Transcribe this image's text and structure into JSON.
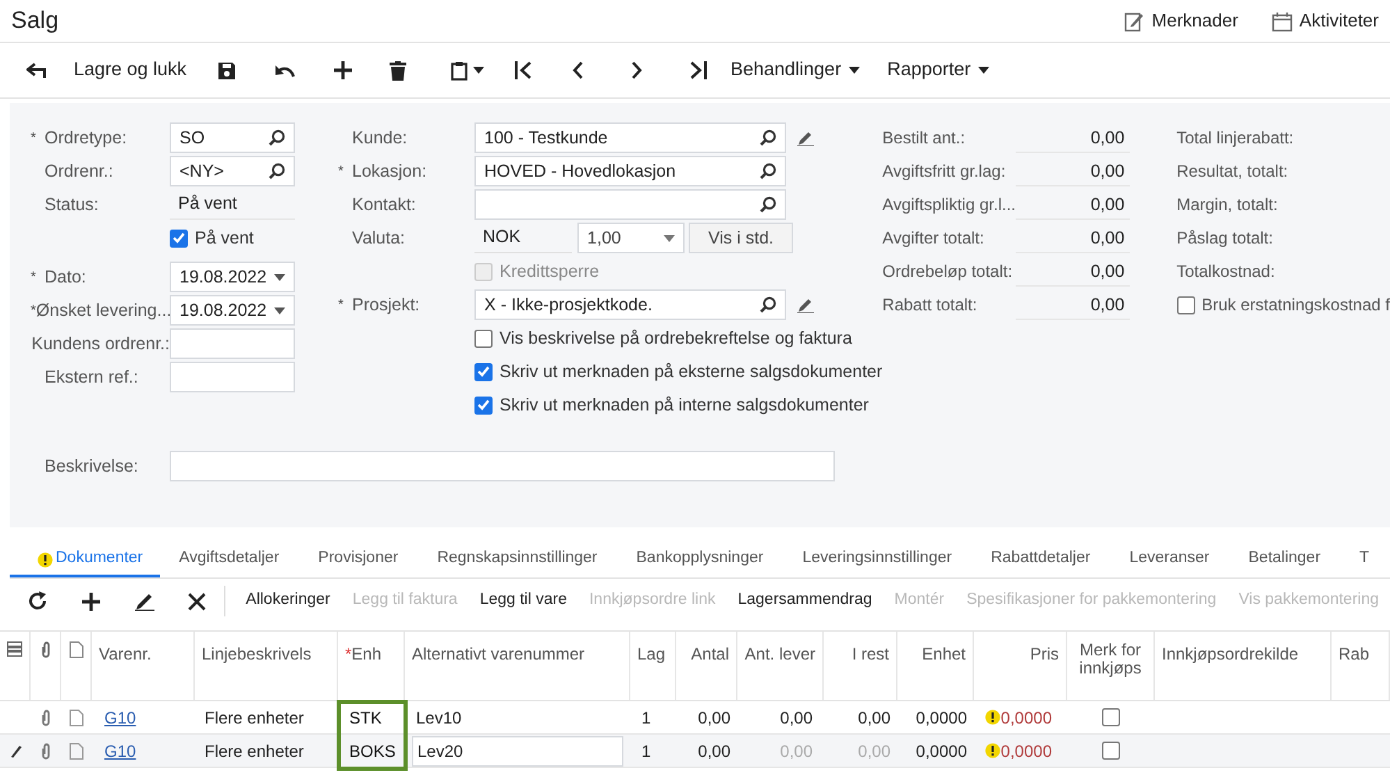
{
  "title": "Salg",
  "header_links": [
    {
      "kind": "notes",
      "label": "Merknader"
    },
    {
      "kind": "calendar",
      "label": "Aktiviteter"
    }
  ],
  "toolbar": [
    {
      "kind": "back"
    },
    {
      "kind": "text",
      "label": "Lagre og lukk"
    },
    {
      "kind": "save"
    },
    {
      "kind": "undo"
    },
    {
      "kind": "add"
    },
    {
      "kind": "delete"
    },
    {
      "kind": "clipboard"
    },
    {
      "kind": "first"
    },
    {
      "kind": "prev"
    },
    {
      "kind": "next"
    },
    {
      "kind": "last"
    },
    {
      "kind": "menu",
      "label": "Behandlinger"
    },
    {
      "kind": "menu",
      "label": "Rapporter"
    }
  ],
  "form_left": [
    {
      "kind": "lookup",
      "label": "Ordretype:",
      "mark": "*",
      "value": "SO"
    },
    {
      "kind": "lookup",
      "label": "Ordrenr.:",
      "value": "<NY>"
    },
    {
      "kind": "static",
      "label": "Status:",
      "value": "På vent"
    },
    {
      "kind": "checkbox",
      "label": "På vent",
      "checked": true,
      "disabled": false
    },
    {
      "kind": "date",
      "label": "Dato:",
      "mark": "*",
      "value": "19.08.2022"
    },
    {
      "kind": "date",
      "label": "Ønsket levering...",
      "mark": "*",
      "value": "19.08.2022"
    },
    {
      "kind": "input",
      "label": "Kundens ordrenr.:"
    },
    {
      "kind": "input",
      "label": "Ekstern ref.:"
    }
  ],
  "form_middle": [
    {
      "kind": "lookup",
      "label": "Kunde:",
      "value": "100 - Testkunde",
      "editable": true
    },
    {
      "kind": "lookup",
      "label": "Lokasjon:",
      "mark": "*",
      "value": "HOVED - Hovedlokasjon",
      "editable": false
    },
    {
      "kind": "lookup",
      "label": "Kontakt:",
      "editable": false
    },
    {
      "kind": "currency",
      "label": "Valuta:",
      "value": "NOK",
      "rate": "1,00",
      "button": "Vis i std."
    },
    {
      "kind": "checkbox",
      "label": "Kredittsperre",
      "checked": false,
      "disabled": true
    },
    {
      "kind": "lookup",
      "label": "Prosjekt:",
      "mark": "*",
      "value": "X - Ikke-prosjektkode.",
      "editable": true
    },
    {
      "kind": "checkbox",
      "label": "Vis beskrivelse på ordrebekreftelse og faktura",
      "checked": false,
      "disabled": false
    },
    {
      "kind": "checkbox",
      "label": "Skriv ut merknaden på eksterne salgsdokumenter",
      "checked": true,
      "disabled": false
    },
    {
      "kind": "checkbox",
      "label": "Skriv ut merknaden på interne salgsdokumenter",
      "checked": true,
      "disabled": false
    }
  ],
  "summary": [
    {
      "label": "Bestilt ant.:",
      "value": "0,00"
    },
    {
      "label": "Avgiftsfritt gr.lag:",
      "value": "0,00"
    },
    {
      "label": "Avgiftspliktig gr.l...",
      "value": "0,00"
    },
    {
      "label": "Avgifter totalt:",
      "value": "0,00"
    },
    {
      "label": "Ordrebeløp totalt:",
      "value": "0,00"
    },
    {
      "label": "Rabatt totalt:",
      "value": "0,00"
    }
  ],
  "totals": [
    {
      "kind": "label",
      "label": "Total linjerabatt:"
    },
    {
      "kind": "label",
      "label": "Resultat, totalt:"
    },
    {
      "kind": "label",
      "label": "Margin, totalt:"
    },
    {
      "kind": "label",
      "label": "Påslag totalt:"
    },
    {
      "kind": "label",
      "label": "Totalkostnad:"
    },
    {
      "kind": "checkbox",
      "label": "Bruk erstatningskostnad f",
      "checked": false
    }
  ],
  "description": {
    "label": "Beskrivelse:"
  },
  "tabs": [
    {
      "label": "Dokumenter",
      "selected": true,
      "warning": true
    },
    {
      "label": "Avgiftsdetaljer",
      "selected": false,
      "warning": false
    },
    {
      "label": "Provisjoner",
      "selected": false,
      "warning": false
    },
    {
      "label": "Regnskapsinnstillinger",
      "selected": false,
      "warning": false
    },
    {
      "label": "Bankopplysninger",
      "selected": false,
      "warning": false
    },
    {
      "label": "Leveringsinnstillinger",
      "selected": false,
      "warning": false
    },
    {
      "label": "Rabattdetaljer",
      "selected": false,
      "warning": false
    },
    {
      "label": "Leveranser",
      "selected": false,
      "warning": false
    },
    {
      "label": "Betalinger",
      "selected": false,
      "warning": false
    },
    {
      "label": "T",
      "selected": false,
      "warning": false
    }
  ],
  "grid_toolbar": [
    {
      "kind": "refresh"
    },
    {
      "kind": "add"
    },
    {
      "kind": "edit"
    },
    {
      "kind": "remove"
    },
    {
      "kind": "text",
      "label": "Allokeringer",
      "disabled": false
    },
    {
      "kind": "text",
      "label": "Legg til faktura",
      "disabled": true
    },
    {
      "kind": "text",
      "label": "Legg til vare",
      "disabled": false
    },
    {
      "kind": "text",
      "label": "Innkjøpsordre link",
      "disabled": true
    },
    {
      "kind": "text",
      "label": "Lagersammendrag",
      "disabled": false
    },
    {
      "kind": "text",
      "label": "Montér",
      "disabled": true
    },
    {
      "kind": "text",
      "label": "Spesifikasjoner for pakkemontering",
      "disabled": true
    },
    {
      "kind": "text",
      "label": "Vis pakkemontering",
      "disabled": true
    }
  ],
  "table": {
    "columns": [
      {
        "kind": "grid"
      },
      {
        "kind": "files"
      },
      {
        "kind": "notes"
      },
      {
        "kind": "text",
        "label": "Varenr."
      },
      {
        "kind": "text",
        "label": "Linjebeskrivels"
      },
      {
        "kind": "text",
        "label": "Enh",
        "mark": "*",
        "highlighted": true
      },
      {
        "kind": "text",
        "label": "Alternativt varenummer"
      },
      {
        "kind": "text",
        "label": "Lag"
      },
      {
        "kind": "number",
        "label": "Antal"
      },
      {
        "kind": "number",
        "label": "Ant. lever"
      },
      {
        "kind": "number",
        "label": "I rest"
      },
      {
        "kind": "number",
        "label": "Enhet"
      },
      {
        "kind": "number",
        "label": "Pris"
      },
      {
        "kind": "check",
        "label": "Merk for innkjøps"
      },
      {
        "kind": "text",
        "label": "Innkjøpsordrekilde"
      },
      {
        "kind": "text",
        "label": "Rab"
      }
    ],
    "rows": [
      {
        "editing": false,
        "locked": false,
        "item": "G10",
        "description": "Flere enheter",
        "unit": "STK",
        "alt_item": "Lev10",
        "warehouse": "1",
        "qty": "0,00",
        "shipped": "0,00",
        "open": "0,00",
        "unit_price": "0,0000",
        "price": "0,0000",
        "price_warning": true,
        "mark_po": false
      },
      {
        "editing": true,
        "locked": true,
        "item": "G10",
        "description": "Flere enheter",
        "unit": "BOKS",
        "alt_item": "Lev20",
        "warehouse": "1",
        "qty": "0,00",
        "shipped": "0,00",
        "open": "0,00",
        "unit_price": "0,0000",
        "price": "0,0000",
        "price_warning": true,
        "mark_po": false
      }
    ]
  }
}
